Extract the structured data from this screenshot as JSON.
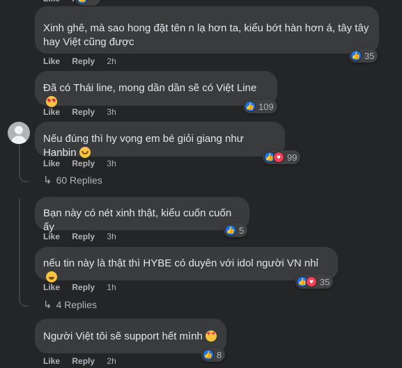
{
  "comments": [
    {
      "text": "Xinh ghê, mà sao hong đặt tên n lạ hơn ta, kiểu bớt hàn hơn á, tây tây hay Việt cũng được",
      "like": "Like",
      "reply": "Reply",
      "time": "2h",
      "reactions": [
        "like"
      ],
      "count": "35"
    },
    {
      "text": "Đã có Thái line, mong dần dần sẽ có Việt Line",
      "emoji": "kiss",
      "like": "Like",
      "reply": "Reply",
      "time": "3h",
      "reactions": [
        "like"
      ],
      "count": "109"
    },
    {
      "text": "Nếu đúng thì hy vọng em bé giỏi giang như Hanbin",
      "emoji": "hug",
      "like": "Like",
      "reply": "Reply",
      "time": "3h",
      "reactions": [
        "like",
        "love"
      ],
      "count": "99"
    },
    {
      "text": "Bạn này có nét xinh thật, kiểu cuốn cuốn ấy",
      "like": "Like",
      "reply": "Reply",
      "time": "3h",
      "reactions": [
        "like"
      ],
      "count": "5"
    },
    {
      "text": "nếu tin này là thật thì HYBE có duyên với idol người VN nhỉ",
      "emoji": "grin",
      "like": "Like",
      "reply": "Reply",
      "time": "1h",
      "reactions": [
        "like",
        "love"
      ],
      "count": "35"
    },
    {
      "text": "Người Việt tôi sẽ support hết mình",
      "emoji": "heart-eyes",
      "like": "Like",
      "reply": "Reply",
      "time": "2h",
      "reactions": [
        "like"
      ],
      "count": "8"
    }
  ],
  "reply_links": [
    {
      "label": "60 Replies"
    },
    {
      "label": "4 Replies"
    }
  ],
  "icons": {
    "like": "thumbs-up-icon",
    "love": "heart-icon",
    "avatar": "default-avatar-icon",
    "reply_arrow": "reply-arrow-icon"
  },
  "colors": {
    "background": "#242526",
    "bubble": "#3a3b3c",
    "like": "#1877f2",
    "love": "#f33e58",
    "muted": "#b0b3b8"
  }
}
